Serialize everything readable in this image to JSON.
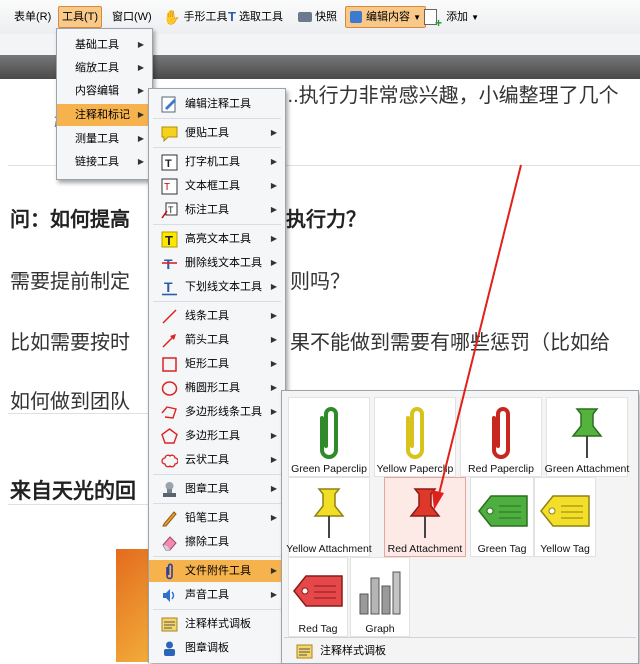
{
  "menubar": {
    "items": [
      "表单(R)",
      "工具(T)",
      "窗口(W)",
      "手形工具",
      "选取工具",
      "快照",
      "编辑内容",
      "添加"
    ],
    "active": "工具(T)"
  },
  "document": {
    "line_top": "...执行力非常感兴趣，小编整理了几个",
    "line_top_frag": "弓",
    "question": "问：如何提高",
    "question_tail": "执行力？",
    "line1": "需要提前制定",
    "line1_tail": "则吗？",
    "line2": "比如需要按时",
    "line2_tail": "果不能做到需要有哪些惩罚（比如给",
    "line3": "如何做到团队",
    "heading2": "来自天光的回"
  },
  "tools_menu": {
    "items": [
      "基础工具",
      "缩放工具",
      "内容编辑",
      "注释和标记",
      "测量工具",
      "链接工具"
    ],
    "highlighted": "注释和标记"
  },
  "annot_menu": {
    "items": [
      "编辑注释工具",
      "便贴工具",
      "打字机工具",
      "文本框工具",
      "标注工具",
      "高亮文本工具",
      "删除线文本工具",
      "下划线文本工具",
      "线条工具",
      "箭头工具",
      "矩形工具",
      "椭圆形工具",
      "多边形线条工具",
      "多边形工具",
      "云状工具",
      "图章工具",
      "铅笔工具",
      "擦除工具",
      "文件附件工具",
      "声音工具",
      "注释样式调板",
      "图章调板"
    ],
    "highlighted": "文件附件工具"
  },
  "attach_panel": {
    "tiles": [
      "Green Paperclip",
      "Yellow Paperclip",
      "Red Paperclip",
      "Green Attachment",
      "Yellow Attachment",
      "Red Attachment",
      "Green Tag",
      "Yellow Tag",
      "Red Tag",
      "Graph"
    ],
    "selected": "Red Attachment",
    "footer": "注释样式调板"
  },
  "colors": {
    "menu_highlight": "#f6b34d",
    "arrow": "#e0201b",
    "dark_bar": "#555555"
  }
}
